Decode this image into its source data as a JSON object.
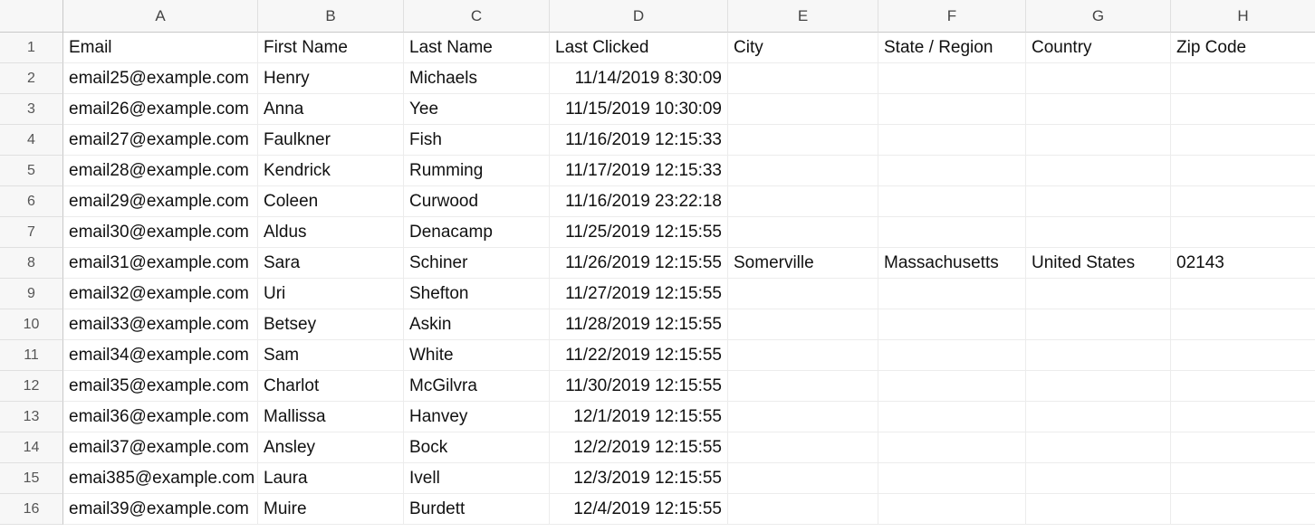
{
  "columns": [
    "A",
    "B",
    "C",
    "D",
    "E",
    "F",
    "G",
    "H"
  ],
  "rowNumbers": [
    1,
    2,
    3,
    4,
    5,
    6,
    7,
    8,
    9,
    10,
    11,
    12,
    13,
    14,
    15,
    16
  ],
  "headers": {
    "A": "Email",
    "B": "First Name",
    "C": "Last Name",
    "D": "Last Clicked",
    "E": "City",
    "F": "State / Region",
    "G": "Country",
    "H": "Zip Code"
  },
  "rows": [
    {
      "A": "email25@example.com",
      "B": "Henry",
      "C": "Michaels",
      "D": "11/14/2019 8:30:09",
      "E": "",
      "F": "",
      "G": "",
      "H": ""
    },
    {
      "A": "email26@example.com",
      "B": "Anna",
      "C": "Yee",
      "D": "11/15/2019 10:30:09",
      "E": "",
      "F": "",
      "G": "",
      "H": ""
    },
    {
      "A": "email27@example.com",
      "B": "Faulkner",
      "C": "Fish",
      "D": "11/16/2019 12:15:33",
      "E": "",
      "F": "",
      "G": "",
      "H": ""
    },
    {
      "A": "email28@example.com",
      "B": "Kendrick",
      "C": "Rumming",
      "D": "11/17/2019 12:15:33",
      "E": "",
      "F": "",
      "G": "",
      "H": ""
    },
    {
      "A": "email29@example.com",
      "B": "Coleen",
      "C": "Curwood",
      "D": "11/16/2019 23:22:18",
      "E": "",
      "F": "",
      "G": "",
      "H": ""
    },
    {
      "A": "email30@example.com",
      "B": "Aldus",
      "C": "Denacamp",
      "D": "11/25/2019 12:15:55",
      "E": "",
      "F": "",
      "G": "",
      "H": ""
    },
    {
      "A": "email31@example.com",
      "B": "Sara",
      "C": "Schiner",
      "D": "11/26/2019 12:15:55",
      "E": "Somerville",
      "F": "Massachusetts",
      "G": "United States",
      "H": "02143"
    },
    {
      "A": "email32@example.com",
      "B": "Uri",
      "C": "Shefton",
      "D": "11/27/2019 12:15:55",
      "E": "",
      "F": "",
      "G": "",
      "H": ""
    },
    {
      "A": "email33@example.com",
      "B": "Betsey",
      "C": "Askin",
      "D": "11/28/2019 12:15:55",
      "E": "",
      "F": "",
      "G": "",
      "H": ""
    },
    {
      "A": "email34@example.com",
      "B": "Sam",
      "C": "White",
      "D": "11/22/2019 12:15:55",
      "E": "",
      "F": "",
      "G": "",
      "H": ""
    },
    {
      "A": "email35@example.com",
      "B": "Charlot",
      "C": "McGilvra",
      "D": "11/30/2019 12:15:55",
      "E": "",
      "F": "",
      "G": "",
      "H": ""
    },
    {
      "A": "email36@example.com",
      "B": "Mallissa",
      "C": "Hanvey",
      "D": "12/1/2019 12:15:55",
      "E": "",
      "F": "",
      "G": "",
      "H": ""
    },
    {
      "A": "email37@example.com",
      "B": "Ansley",
      "C": "Bock",
      "D": "12/2/2019 12:15:55",
      "E": "",
      "F": "",
      "G": "",
      "H": ""
    },
    {
      "A": "emai385@example.com",
      "B": "Laura",
      "C": "Ivell",
      "D": "12/3/2019 12:15:55",
      "E": "",
      "F": "",
      "G": "",
      "H": ""
    },
    {
      "A": "email39@example.com",
      "B": "Muire",
      "C": "Burdett",
      "D": "12/4/2019 12:15:55",
      "E": "",
      "F": "",
      "G": "",
      "H": ""
    }
  ]
}
